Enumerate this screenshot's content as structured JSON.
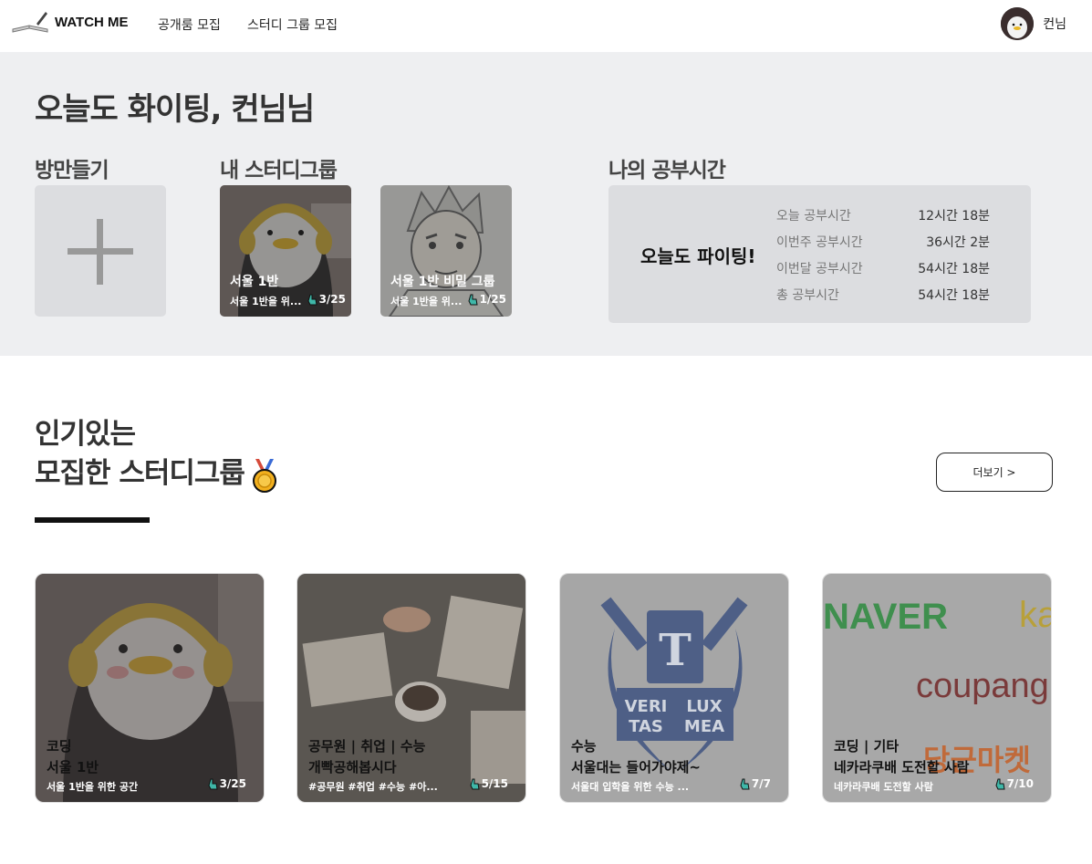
{
  "header": {
    "logo_text": "WATCH ME",
    "nav": [
      "공개룸 모집",
      "스터디 그룹 모집"
    ],
    "user_name": "컨님"
  },
  "top": {
    "greeting": "오늘도 화이팅, 컨님님",
    "make_room_title": "방만들기",
    "my_groups_title": "내 스터디그룹",
    "study_time_title": "나의 공부시간",
    "my_groups": [
      {
        "title": "서울 1반",
        "desc": "서울 1반을 위...",
        "count": "3/25"
      },
      {
        "title": "서울 1반 비밀 그룹",
        "desc": "서울 1반을 위...",
        "count": "1/25"
      }
    ],
    "study_time": {
      "cheer": "오늘도 파이팅!",
      "rows": [
        {
          "label": "오늘 공부시간",
          "value": "12시간 18분"
        },
        {
          "label": "이번주 공부시간",
          "value": "36시간 2분"
        },
        {
          "label": "이번달 공부시간",
          "value": "54시간 18분"
        },
        {
          "label": "총 공부시간",
          "value": "54시간 18분"
        }
      ]
    }
  },
  "popular": {
    "title_line1": "인기있는",
    "title_line2": "모집한 스터디그룹",
    "more_label": "더보기 >",
    "cards": [
      {
        "category": "코딩",
        "title": "서울 1반",
        "desc": "서울 1반을 위한 공간",
        "count": "3/25"
      },
      {
        "category": "공무원 | 취업 | 수능",
        "title": "개빡공해봅시다",
        "desc": "#공무원 #취업 #수능 #아...",
        "count": "5/15"
      },
      {
        "category": "수능",
        "title": "서울대는 들어가야제~",
        "desc": "서울대 입학을 위한 수능 ...",
        "count": "7/7"
      },
      {
        "category": "코딩 | 기타",
        "title": "네카라쿠배 도전할 사람",
        "desc": "네카라쿠배 도전할 사람",
        "count": "7/10"
      }
    ]
  },
  "colors": {
    "top_bg": "#eeeff1",
    "box_bg": "#dcdde0",
    "underline": "#111111"
  }
}
